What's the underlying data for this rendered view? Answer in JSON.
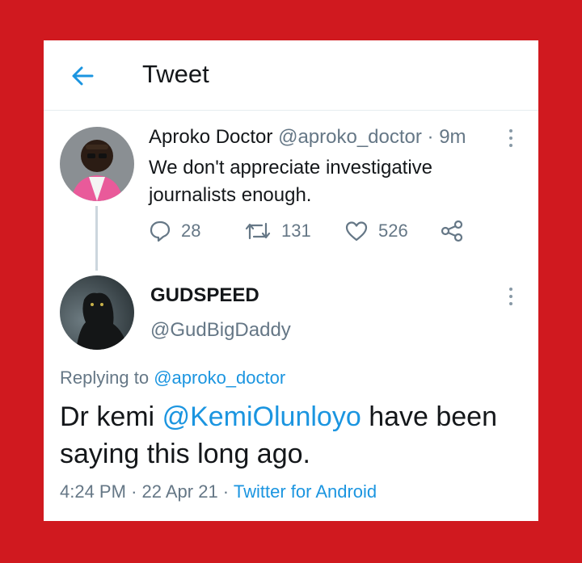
{
  "header": {
    "title": "Tweet"
  },
  "parent_tweet": {
    "name": "Aproko Doctor",
    "handle": "@aproko_doctor",
    "time": "· 9m",
    "text": "We don't appreciate investigative journalists enough.",
    "replies": "28",
    "retweets": "131",
    "likes": "526"
  },
  "reply_tweet": {
    "name": "GUDSPEED",
    "handle": "@GudBigDaddy",
    "replying_label": "Replying to",
    "replying_to": "@aproko_doctor",
    "text_before": "Dr kemi",
    "mention": "@KemiOlunloyo",
    "text_after": "have been saying this long ago.",
    "time": "4:24 PM",
    "date": "· 22 Apr 21 ·",
    "source": "Twitter for Android"
  },
  "colors": {
    "frame": "#d0191f",
    "accent": "#1b95e0",
    "muted": "#657786"
  },
  "icons": {
    "back": "arrow-left-icon",
    "more": "vertical-ellipsis-icon",
    "reply": "speech-bubble-icon",
    "retweet": "retweet-icon",
    "like": "heart-icon",
    "share": "share-icon"
  }
}
